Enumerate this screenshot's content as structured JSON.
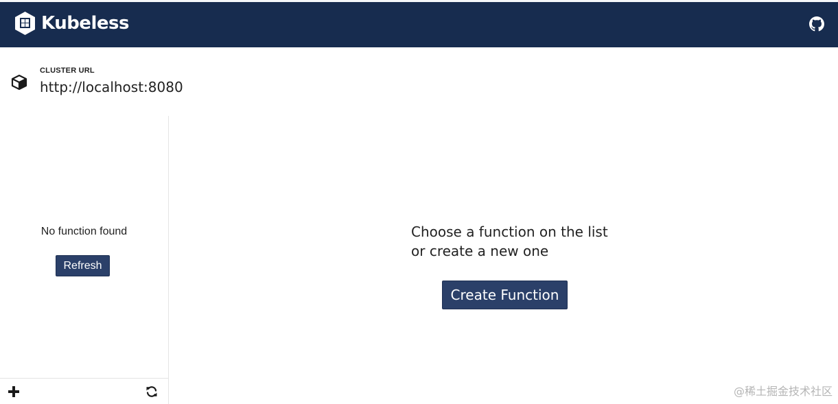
{
  "header": {
    "brand_name": "Kubeless",
    "logo_icon": "kubeless-logo-icon",
    "github_icon": "github-icon",
    "background_color": "#172c4f"
  },
  "cluster": {
    "label": "CLUSTER URL",
    "url": "http://localhost:8080",
    "icon": "cube-icon"
  },
  "sidebar": {
    "empty_message": "No function found",
    "refresh_label": "Refresh",
    "footer": {
      "add_icon": "plus-icon",
      "refresh_icon": "refresh-icon"
    }
  },
  "main": {
    "prompt_line_1": "Choose a function on the list",
    "prompt_line_2": "or create a new one",
    "create_label": "Create Function"
  },
  "watermark": {
    "text": "@稀土掘金技术社区"
  },
  "colors": {
    "accent": "#2b4069",
    "header": "#172c4f"
  }
}
